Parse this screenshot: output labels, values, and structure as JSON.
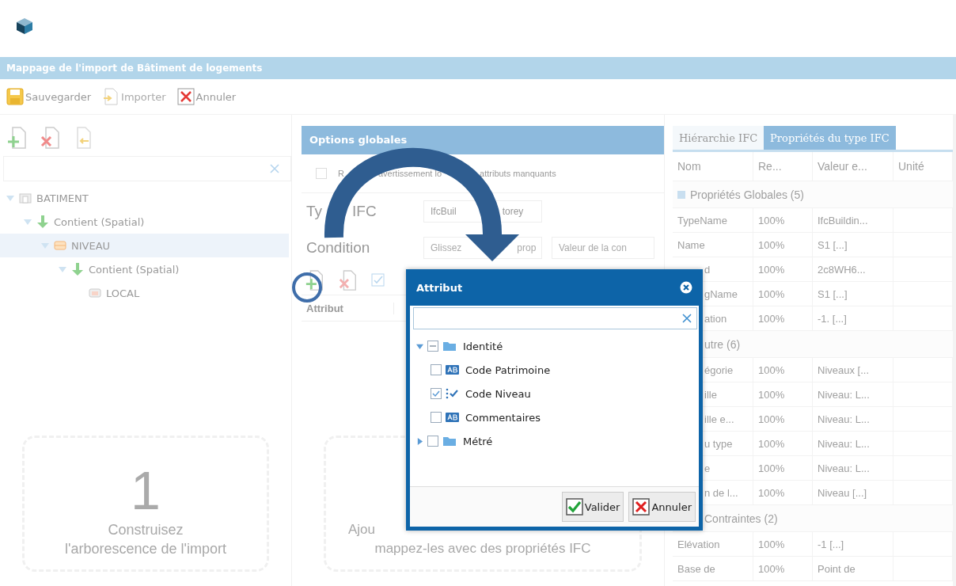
{
  "window": {
    "title": "Mappage de l'import de Bâtiment de logements"
  },
  "toolbar": [
    {
      "label": "Sauvegarder",
      "kind": "save",
      "disabled": false
    },
    {
      "label": "Importer",
      "kind": "import",
      "disabled": true
    },
    {
      "label": "Annuler",
      "kind": "cancel",
      "disabled": false
    }
  ],
  "tree": [
    {
      "label": "BATIMENT",
      "kind": "building",
      "expanded": true,
      "selected": false,
      "children": [
        {
          "label": "Contient (Spatial)",
          "kind": "relation",
          "expanded": true,
          "selected": false,
          "children": [
            {
              "label": "NIVEAU",
              "kind": "level",
              "expanded": true,
              "selected": true,
              "children": [
                {
                  "label": "Contient (Spatial)",
                  "kind": "relation",
                  "expanded": true,
                  "selected": false,
                  "children": [
                    {
                      "label": "LOCAL",
                      "kind": "room",
                      "selected": false
                    }
                  ]
                }
              ]
            }
          ]
        }
      ]
    }
  ],
  "left_card": {
    "number": "1",
    "lines": [
      "Construisez",
      "l'arborescence de l'import"
    ]
  },
  "options": {
    "title": "Options globales",
    "warning": {
      "checked": false,
      "fragments": [
        "R",
        "avertissement lo",
        "attributs manquants"
      ]
    },
    "type_label": [
      "Ty",
      "IFC"
    ],
    "type_value": [
      "IfcBuil",
      "torey"
    ],
    "condition_label": "Condition",
    "condition_fields": [
      [
        "Glissez",
        "prop"
      ],
      [
        "Valeur de la con"
      ]
    ],
    "table_header": "Attribut",
    "card_lines": [
      "Ajou",
      "mappez-les avec des propriétés IFC"
    ]
  },
  "right": {
    "tabs": [
      {
        "label": "Hiérarchie IFC",
        "selected": false
      },
      {
        "label": "Propriétés du type IFC",
        "selected": true
      }
    ],
    "columns": [
      "Nom",
      "Re...",
      "Valeur e...",
      "Unité"
    ],
    "groups": [
      {
        "title": "Propriétés Globales (5)",
        "covered": false,
        "rows": [
          {
            "name": "TypeName",
            "covered": false,
            "ratio": "100%",
            "value": "IfcBuildin..."
          },
          {
            "name": "Name",
            "covered": false,
            "ratio": "100%",
            "value": "S1 [...]"
          },
          {
            "name": "d",
            "covered": true,
            "ratio": "100%",
            "value": "2c8WH6..."
          },
          {
            "name": "gName",
            "covered": true,
            "ratio": "100%",
            "value": "S1 [...]"
          },
          {
            "name": "ation",
            "covered": true,
            "ratio": "100%",
            "value": "-1. [...]"
          }
        ]
      },
      {
        "title": "utre (6)",
        "covered": true,
        "rows": [
          {
            "name": "égorie",
            "covered": true,
            "ratio": "100%",
            "value": "Niveaux [..."
          },
          {
            "name": "ille",
            "covered": true,
            "ratio": "100%",
            "value": "Niveau: L..."
          },
          {
            "name": "ille e...",
            "covered": true,
            "ratio": "100%",
            "value": "Niveau: L..."
          },
          {
            "name": "u type",
            "covered": true,
            "ratio": "100%",
            "value": "Niveau: L..."
          },
          {
            "name": "e",
            "covered": true,
            "ratio": "100%",
            "value": "Niveau: L..."
          },
          {
            "name": "n de l...",
            "covered": true,
            "ratio": "100%",
            "value": "Niveau [...]"
          }
        ]
      },
      {
        "title": "Contraintes (2)",
        "covered": true,
        "rows": [
          {
            "name": "Elévation",
            "covered": false,
            "ratio": "100%",
            "value": "-1 [...]"
          },
          {
            "name": "Base de",
            "covered": false,
            "ratio": "100%",
            "value": "Point de"
          }
        ]
      }
    ]
  },
  "dialog": {
    "title": "Attribut",
    "tree": [
      {
        "label": "Identité",
        "kind": "folder",
        "expanded": true,
        "checked": false,
        "indeterminate": true,
        "children": [
          {
            "label": "Code Patrimoine",
            "kind": "text",
            "checked": false
          },
          {
            "label": "Code Niveau",
            "kind": "boolean",
            "checked": true
          },
          {
            "label": "Commentaires",
            "kind": "text",
            "checked": false
          }
        ]
      },
      {
        "label": "Métré",
        "kind": "folder",
        "expanded": false,
        "checked": false,
        "indeterminate": false
      }
    ],
    "buttons": [
      {
        "label": "Valider",
        "kind": "ok"
      },
      {
        "label": "Annuler",
        "kind": "cancel"
      }
    ]
  }
}
